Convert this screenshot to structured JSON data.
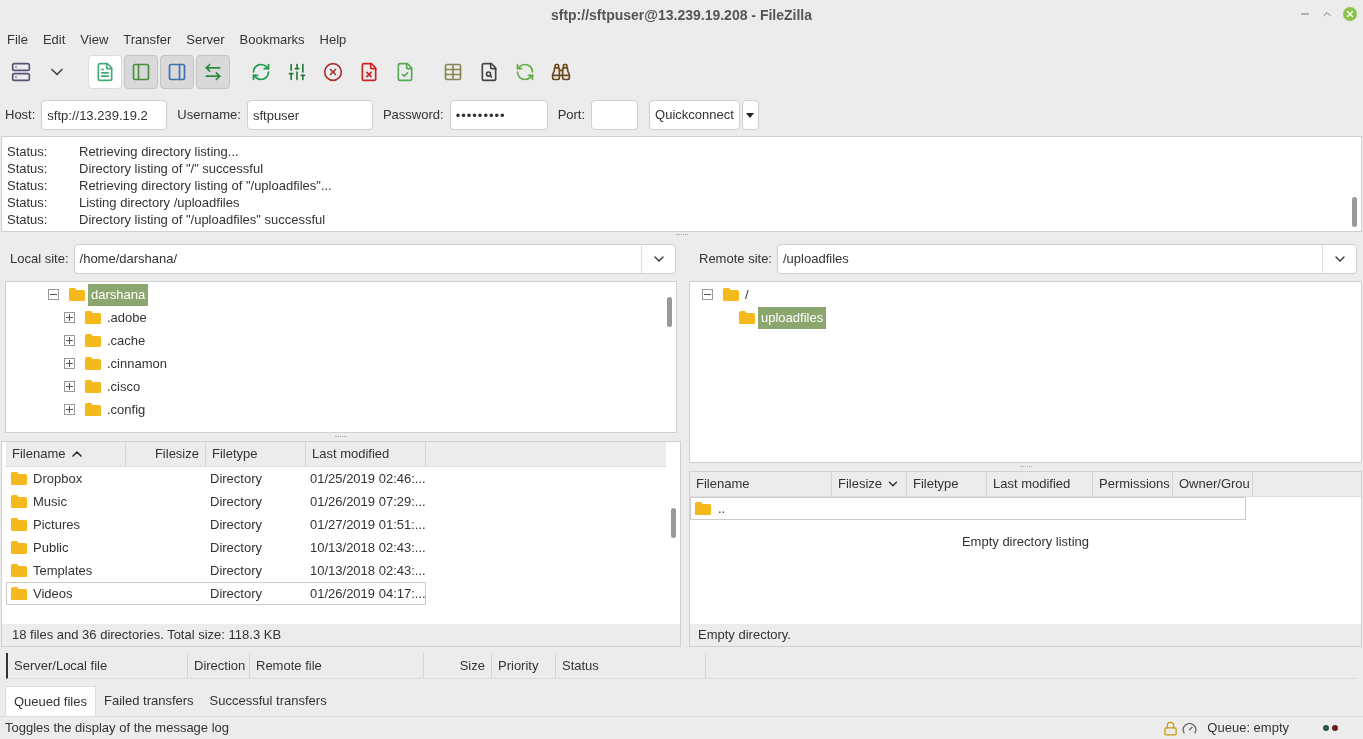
{
  "window": {
    "title": "sftp://sftpuser@13.239.19.208 - FileZilla"
  },
  "menu": [
    "File",
    "Edit",
    "View",
    "Transfer",
    "Server",
    "Bookmarks",
    "Help"
  ],
  "toolbar": {
    "toggles": [
      {
        "on": true,
        "hovered": true
      },
      {
        "on": true,
        "hovered": false
      },
      {
        "on": true,
        "hovered": false
      },
      {
        "on": true,
        "hovered": false
      }
    ]
  },
  "quickconnect": {
    "fields": [
      {
        "label": "Host:",
        "value": "sftp://13.239.19.2",
        "kind": "text"
      },
      {
        "label": "Username:",
        "value": "sftpuser",
        "kind": "text"
      },
      {
        "label": "Password:",
        "value": "•••••••••",
        "kind": "password"
      },
      {
        "label": "Port:",
        "kind": "port"
      }
    ],
    "button": "Quickconnect"
  },
  "message_log": [
    {
      "label": "Status:",
      "message": "Retrieving directory listing..."
    },
    {
      "label": "Status:",
      "message": "Directory listing of \"/\" successful"
    },
    {
      "label": "Status:",
      "message": "Retrieving directory listing of \"/uploadfiles\"..."
    },
    {
      "label": "Status:",
      "message": "Listing directory /uploadfiles"
    },
    {
      "label": "Status:",
      "message": "Directory listing of \"/uploadfiles\" successful"
    }
  ],
  "local": {
    "site_label": "Local site:",
    "path": "/home/darshana/",
    "tree": [
      {
        "label": "darshana",
        "expanded": true,
        "has_children": true,
        "selected": true,
        "children": [
          {
            "label": ".adobe",
            "expanded": false,
            "has_children": true,
            "selected": false
          },
          {
            "label": ".cache",
            "expanded": false,
            "has_children": true,
            "selected": false
          },
          {
            "label": ".cinnamon",
            "expanded": false,
            "has_children": true,
            "selected": false
          },
          {
            "label": ".cisco",
            "expanded": false,
            "has_children": true,
            "selected": false
          },
          {
            "label": ".config",
            "expanded": false,
            "has_children": true,
            "selected": false
          }
        ]
      }
    ],
    "columns": [
      {
        "label": "Filename",
        "sorted": true,
        "ascending": true
      },
      {
        "label": "Filesize",
        "sorted": false
      },
      {
        "label": "Filetype",
        "sorted": false
      },
      {
        "label": "Last modified",
        "sorted": false
      }
    ],
    "rows": [
      {
        "cells": [
          "Dropbox",
          "",
          "Directory",
          "01/25/2019 02:46:..."
        ],
        "focused": false
      },
      {
        "cells": [
          "Music",
          "",
          "Directory",
          "01/26/2019 07:29:..."
        ],
        "focused": false
      },
      {
        "cells": [
          "Pictures",
          "",
          "Directory",
          "01/27/2019 01:51:..."
        ],
        "focused": false
      },
      {
        "cells": [
          "Public",
          "",
          "Directory",
          "10/13/2018 02:43:..."
        ],
        "focused": false
      },
      {
        "cells": [
          "Templates",
          "",
          "Directory",
          "10/13/2018 02:43:..."
        ],
        "focused": false
      },
      {
        "cells": [
          "Videos",
          "",
          "Directory",
          "01/26/2019 04:17:..."
        ],
        "focused": true
      }
    ],
    "status": "18 files and 36 directories. Total size: 118.3 KB"
  },
  "remote": {
    "site_label": "Remote site:",
    "path": "/uploadfiles",
    "tree": [
      {
        "label": "/",
        "expanded": true,
        "has_children": true,
        "selected": false,
        "children": [
          {
            "label": "uploadfiles",
            "has_children": false,
            "selected": true
          }
        ]
      }
    ],
    "columns": [
      {
        "label": "Filename",
        "sorted": false
      },
      {
        "label": "Filesize",
        "sorted": true,
        "ascending": false
      },
      {
        "label": "Filetype",
        "sorted": false
      },
      {
        "label": "Last modified",
        "sorted": false
      },
      {
        "label": "Permissions",
        "sorted": false
      },
      {
        "label": "Owner/Grou",
        "sorted": false
      }
    ],
    "rows": [
      {
        "cells": [
          ".."
        ],
        "focused": true
      }
    ],
    "empty_message": "Empty directory listing",
    "status": "Empty directory."
  },
  "queue": {
    "columns": [
      {
        "label": "Server/Local file"
      },
      {
        "label": "Direction"
      },
      {
        "label": "Remote file"
      },
      {
        "label": "Size"
      },
      {
        "label": "Priority"
      },
      {
        "label": "Status"
      }
    ],
    "tabs": [
      {
        "label": "Queued files",
        "selected": true
      },
      {
        "label": "Failed transfers",
        "selected": false
      },
      {
        "label": "Successful transfers",
        "selected": false
      }
    ]
  },
  "status_bar": {
    "hint": "Toggles the display of the message log",
    "queue": "Queue: empty"
  }
}
